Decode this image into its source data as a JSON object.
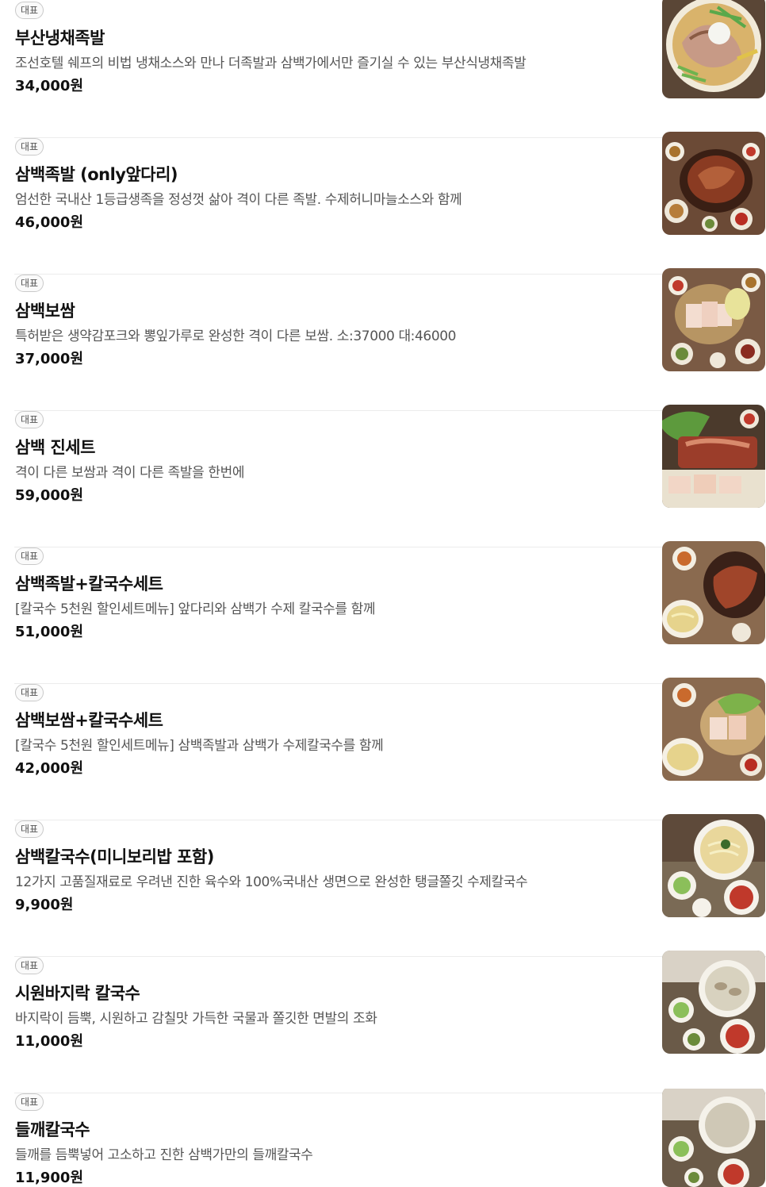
{
  "badge_label": "대표",
  "currency_suffix": "원",
  "items": [
    {
      "name": "부산냉채족발",
      "description": "조선호텔 쉐프의 비법 냉채소스와 만나 더족발과 삼백가에서만 즐기실 수 있는 부산식냉채족발",
      "price": "34,000원",
      "image": "busan-cold-jokbal-photo"
    },
    {
      "name": "삼백족발 (only앞다리)",
      "description": "엄선한 국내산 1등급생족을 정성껏 삶아 격이 다른 족발. 수제허니마늘소스와 함께",
      "price": "46,000원",
      "image": "jokbal-photo"
    },
    {
      "name": "삼백보쌈",
      "description": "특허받은 생약감포크와 뽕잎가루로 완성한 격이 다른 보쌈. 소:37000 대:46000",
      "price": "37,000원",
      "image": "bossam-photo"
    },
    {
      "name": "삼백 진세트",
      "description": "격이 다른 보쌈과 격이 다른 족발을 한번에",
      "price": "59,000원",
      "image": "jin-set-photo"
    },
    {
      "name": "삼백족발+칼국수세트",
      "description": "[칼국수 5천원 할인세트메뉴] 앞다리와 삼백가 수제 칼국수를 함께",
      "price": "51,000원",
      "image": "jokbal-kalguksu-set-photo"
    },
    {
      "name": "삼백보쌈+칼국수세트",
      "description": "[칼국수 5천원 할인세트메뉴] 삼백족발과 삼백가 수제칼국수를 함께",
      "price": "42,000원",
      "image": "bossam-kalguksu-set-photo"
    },
    {
      "name": "삼백칼국수(미니보리밥 포함)",
      "description": "12가지 고품질재료로 우려낸 진한 육수와 100%국내산 생면으로 완성한 탱글쫄깃 수제칼국수",
      "price": "9,900원",
      "image": "kalguksu-photo"
    },
    {
      "name": "시원바지락 칼국수",
      "description": "바지락이 듬뿍, 시원하고 감칠맛 가득한 국물과 쫄깃한 면발의 조화",
      "price": "11,000원",
      "image": "clam-kalguksu-photo"
    },
    {
      "name": "들깨칼국수",
      "description": "들깨를 듬뿍넣어 고소하고 진한 삼백가만의 들깨칼국수",
      "price": "11,900원",
      "image": "perilla-kalguksu-photo"
    }
  ]
}
